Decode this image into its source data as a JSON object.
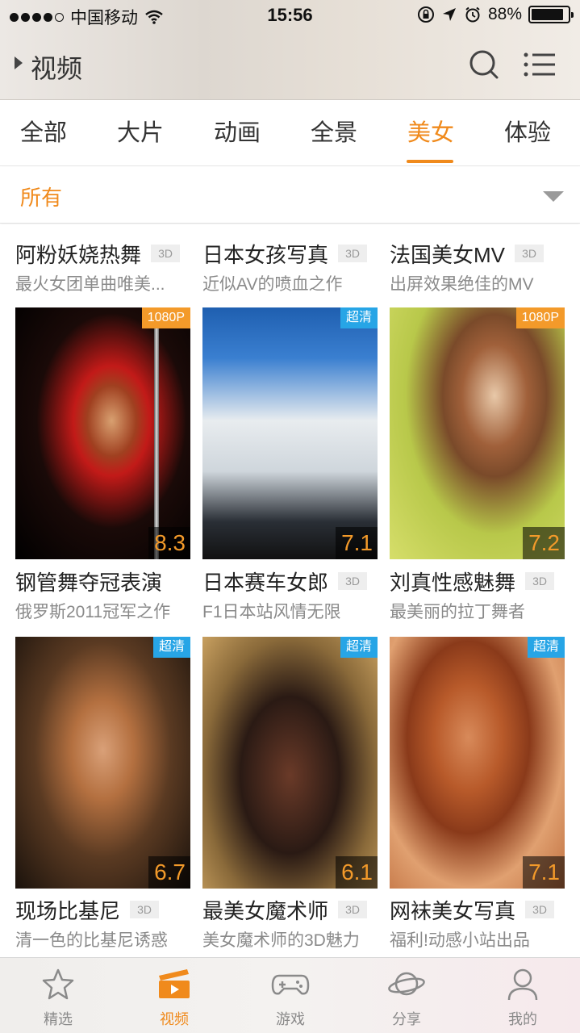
{
  "status_bar": {
    "carrier": "中国移动",
    "time": "15:56",
    "battery_percent": "88%",
    "battery_level": 0.88,
    "signal_bars": 4
  },
  "header": {
    "title": "视频",
    "icons": [
      "search-icon",
      "menu-icon"
    ]
  },
  "category_tabs": [
    {
      "label": "全部",
      "active": false
    },
    {
      "label": "大片",
      "active": false
    },
    {
      "label": "动画",
      "active": false
    },
    {
      "label": "全景",
      "active": false
    },
    {
      "label": "美女",
      "active": true
    },
    {
      "label": "体验",
      "active": false
    }
  ],
  "filter": {
    "selected": "所有"
  },
  "grid": {
    "rows": [
      [
        {
          "title": "阿粉妖娆热舞",
          "tag": "3D",
          "subtitle": "最火女团单曲唯美..."
        },
        {
          "title": "日本女孩写真",
          "tag": "3D",
          "subtitle": "近似AV的喷血之作"
        },
        {
          "title": "法国美女MV",
          "tag": "3D",
          "subtitle": "出屏效果绝佳的MV"
        }
      ],
      [
        {
          "title": "钢管舞夺冠表演",
          "tag": "",
          "subtitle": "俄罗斯2011冠军之作",
          "badge": "1080P",
          "badge_color": "#f39a2a",
          "score": "8.3"
        },
        {
          "title": "日本赛车女郎",
          "tag": "3D",
          "subtitle": "F1日本站风情无限",
          "badge": "超清",
          "badge_color": "#27a5e6",
          "score": "7.1"
        },
        {
          "title": "刘真性感魅舞",
          "tag": "3D",
          "subtitle": "最美丽的拉丁舞者",
          "badge": "1080P",
          "badge_color": "#f39a2a",
          "score": "7.2"
        }
      ],
      [
        {
          "title": "现场比基尼",
          "tag": "3D",
          "subtitle": "清一色的比基尼诱惑",
          "badge": "超清",
          "badge_color": "#27a5e6",
          "score": "6.7"
        },
        {
          "title": "最美女魔术师",
          "tag": "3D",
          "subtitle": "美女魔术师的3D魅力",
          "badge": "超清",
          "badge_color": "#27a5e6",
          "score": "6.1"
        },
        {
          "title": "网袜美女写真",
          "tag": "3D",
          "subtitle": "福利!动感小站出品",
          "badge": "超清",
          "badge_color": "#27a5e6",
          "score": "7.1"
        }
      ]
    ]
  },
  "tab_bar": [
    {
      "label": "精选",
      "icon": "star-icon",
      "active": false
    },
    {
      "label": "视频",
      "icon": "video-icon",
      "active": true
    },
    {
      "label": "游戏",
      "icon": "gamepad-icon",
      "active": false
    },
    {
      "label": "分享",
      "icon": "planet-icon",
      "active": false
    },
    {
      "label": "我的",
      "icon": "user-icon",
      "active": false
    }
  ],
  "colors": {
    "accent": "#f08a1c",
    "badge_orange": "#f39a2a",
    "badge_blue": "#27a5e6"
  }
}
